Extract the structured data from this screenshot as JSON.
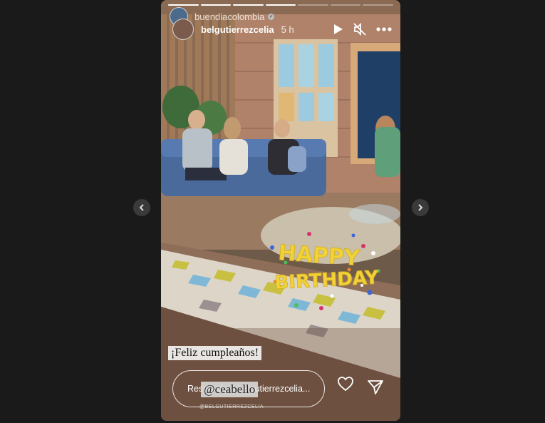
{
  "viewer": {
    "prev_icon": "chevron-left-icon",
    "next_icon": "chevron-right-icon"
  },
  "story": {
    "progress_segments": 7,
    "progress_completed": 4,
    "account": "buendiacolombia",
    "author": "belgutierrezcelia",
    "time": "5 h",
    "caption": "¡Feliz cumpleaños!",
    "mention": "@ceabello",
    "mention_sub": "@BELGUTIERREZCELIA",
    "sticker_line1": "HAPPY",
    "sticker_line2": "BIRTHDAY",
    "reply_placeholder": "Responde a belgutierrezcelia..."
  },
  "colors": {
    "page_bg": "#1a1a1a",
    "sticker_yellow": "#f2d23a"
  }
}
